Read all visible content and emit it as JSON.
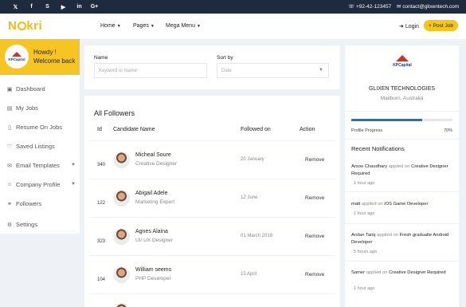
{
  "topbar": {
    "social": [
      {
        "icon": "twitter-icon",
        "glyph": "𝕏"
      },
      {
        "icon": "facebook-icon",
        "glyph": "f"
      },
      {
        "icon": "skype-icon",
        "glyph": "S"
      },
      {
        "icon": "youtube-icon",
        "glyph": "▶"
      },
      {
        "icon": "linkedin-icon",
        "glyph": "in"
      },
      {
        "icon": "google-plus-icon",
        "glyph": "G+"
      }
    ],
    "phone": "+92-42-123457",
    "email": "contact@glixentech.com"
  },
  "header": {
    "logo_pre": "N",
    "logo_post": "kri",
    "nav": [
      "Home",
      "Pages",
      "Mega Menu"
    ],
    "login": "Login",
    "post_job": "+ Post Job"
  },
  "sidebar": {
    "greeting": "Howdy !",
    "welcome": "Welcome back",
    "avatar_text": "KPCapital",
    "items": [
      {
        "label": "Dashboard",
        "icon": "dashboard-icon",
        "glyph": "▣"
      },
      {
        "label": "My Jobs",
        "icon": "briefcase-icon",
        "glyph": "▤"
      },
      {
        "label": "Resume On Jobs",
        "icon": "document-icon",
        "glyph": "▯"
      },
      {
        "label": "Saved Listings",
        "icon": "heart-icon",
        "glyph": "♡"
      },
      {
        "label": "Email Templates",
        "icon": "mail-icon",
        "glyph": "✉"
      },
      {
        "label": "Company Profile",
        "icon": "user-icon",
        "glyph": "☺"
      },
      {
        "label": "Followers",
        "icon": "users-icon",
        "glyph": "⚭"
      },
      {
        "label": "Settings",
        "icon": "gear-icon",
        "glyph": "⚙"
      }
    ]
  },
  "filter": {
    "name_label": "Name",
    "name_placeholder": "Keyword or Name",
    "sort_label": "Sort by",
    "sort_value": "Date"
  },
  "followers": {
    "title": "All Followers",
    "columns": [
      "Id",
      "Candidate Name",
      "Followed on",
      "Action"
    ],
    "rows": [
      {
        "id": "340",
        "name": "Micheal Soure",
        "role": "Creative Designer",
        "date": "20 January",
        "action": "Remove"
      },
      {
        "id": "122",
        "name": "Abigail Adele",
        "role": "Marketing Expert",
        "date": "12 June",
        "action": "Remove"
      },
      {
        "id": "323",
        "name": "Agnes Alaina",
        "role": "UI/ UX Designer",
        "date": "01 March 2018",
        "action": "Remove"
      },
      {
        "id": "104",
        "name": "William seems",
        "role": "PHP Developer",
        "date": "15 April",
        "action": "Remove"
      }
    ]
  },
  "company": {
    "logo_text": "KPCapital",
    "name": "GLIXEN TECHNOLOGIES",
    "location": "Mailburn, Australia",
    "progress_label": "Profile Progress",
    "progress_value": "70%",
    "progress_fraction": 0.7,
    "notifications_title": "Recent Notifications",
    "notifications": [
      {
        "user": "Arsoo Chaudhary",
        "verb": "applied on",
        "job": "Creative Designer Required",
        "time": "1 hour ago"
      },
      {
        "user": "matt",
        "verb": "applied on",
        "job": "iOS Game Developer",
        "time": "1 hour ago"
      },
      {
        "user": "Arslan Tariq",
        "verb": "applied on",
        "job": "Fresh gradualte Android Developer",
        "time": "5 hours ago"
      },
      {
        "user": "Samer",
        "verb": "applied on",
        "job": "Creative Designer Required",
        "time": "1 hour ago"
      }
    ]
  },
  "colors": {
    "accent": "#f5c518",
    "topbar": "#1e2a3e",
    "progress": "#1e73b9",
    "page_bg": "#eef1f6"
  }
}
